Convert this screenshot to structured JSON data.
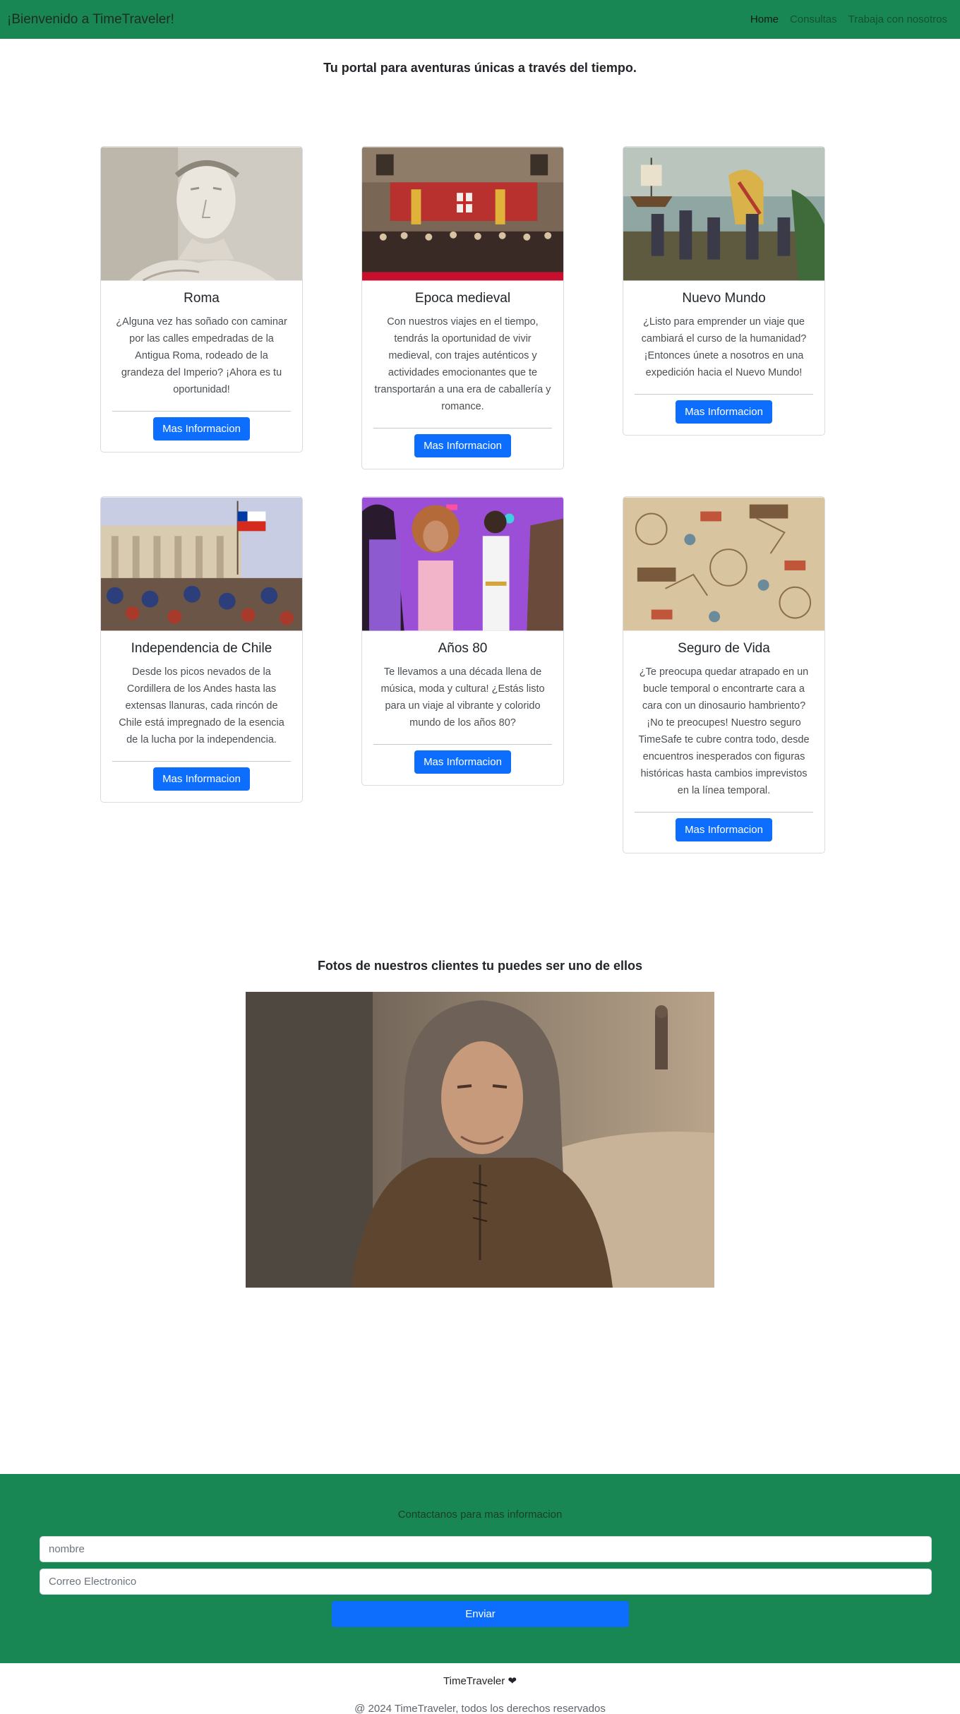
{
  "navbar": {
    "brand": "¡Bienvenido a TimeTraveler!",
    "links": [
      "Home",
      "Consultas",
      "Trabaja con nosotros"
    ]
  },
  "hero": {
    "tagline_pre": "Tu portal para ",
    "tagline_bold": "aventuras únicas",
    "tagline_post": " a través del tiempo."
  },
  "cards": [
    {
      "title": "Roma",
      "text": "¿Alguna vez has soñado con caminar por las calles empedradas de la Antigua Roma, rodeado de la grandeza del Imperio? ¡Ahora es tu oportunidad!",
      "button": "Mas Informacion",
      "image": "roman-statue-photo"
    },
    {
      "title": "Epoca medieval",
      "text": "Con nuestros viajes en el tiempo, tendrás la oportunidad de vivir medieval, con trajes auténticos y actividades emocionantes que te transportarán a una era de caballería y romance.",
      "button": "Mas Informacion",
      "image": "medieval-festival-photo"
    },
    {
      "title": "Nuevo Mundo",
      "text": "¿Listo para emprender un viaje que cambiará el curso de la humanidad? ¡Entonces únete a nosotros en una expedición hacia el Nuevo Mundo!",
      "button": "Mas Informacion",
      "image": "new-world-painting"
    },
    {
      "title": "Independencia de Chile",
      "text": "Desde los picos nevados de la Cordillera de los Andes hasta las extensas llanuras, cada rincón de Chile está impregnado de la esencia de la lucha por la independencia.",
      "button": "Mas Informacion",
      "image": "chile-independence-painting"
    },
    {
      "title": "Años 80",
      "text": "Te llevamos a una década llena de música, moda y cultura! ¿Estás listo para un viaje al vibrante y colorido mundo de los años 80?",
      "button": "Mas Informacion",
      "image": "eighties-collage"
    },
    {
      "title": "Seguro de Vida",
      "text": "¿Te preocupa quedar atrapado en un bucle temporal o encontrarte cara a cara con un dinosaurio hambriento? ¡No te preocupes! Nuestro seguro TimeSafe te cubre contra todo, desde encuentros inesperados con figuras históricas hasta cambios imprevistos en la línea temporal.",
      "button": "Mas Informacion",
      "image": "vintage-travel-pattern"
    }
  ],
  "clients": {
    "title": "Fotos de nuestros clientes tu puedes ser uno de ellos",
    "image": "hooded-traveler-photo"
  },
  "contact": {
    "title": "Contactanos para mas informacion",
    "name_placeholder": "nombre",
    "email_placeholder": "Correo Electronico",
    "submit": "Enviar"
  },
  "footer": {
    "brand": "TimeTraveler ❤",
    "copyright": "@ 2024 TimeTraveler, todos los derechos reservados"
  }
}
